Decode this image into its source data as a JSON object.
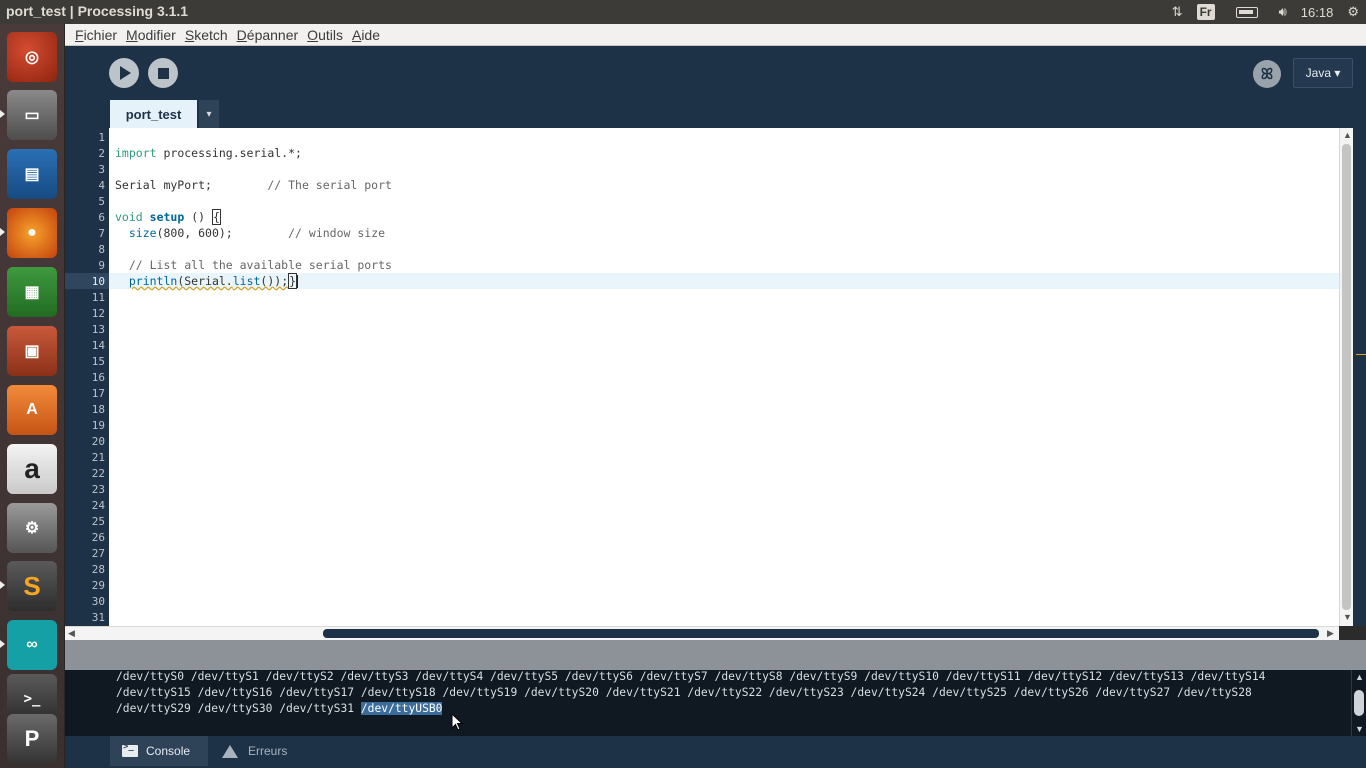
{
  "window": {
    "title": "port_test | Processing 3.1.1"
  },
  "tray": {
    "language": "Fr",
    "time": "16:18"
  },
  "launcher": {
    "apps": [
      "ubuntu-icon",
      "files-icon",
      "writer-icon",
      "firefox-icon",
      "calc-icon",
      "impress-icon",
      "software-center-icon",
      "amazon-icon",
      "system-settings-icon",
      "sublime-text-icon",
      "arduino-icon",
      "terminal-icon",
      "processing-icon"
    ]
  },
  "menu": {
    "items": [
      {
        "first": "F",
        "rest": "ichier"
      },
      {
        "first": "M",
        "rest": "odifier"
      },
      {
        "first": "S",
        "rest": "ketch"
      },
      {
        "first": "D",
        "rest": "épanner"
      },
      {
        "first": "O",
        "rest": "utils"
      },
      {
        "first": "A",
        "rest": "ide"
      }
    ]
  },
  "toolbar": {
    "mode_label": "Java ▾"
  },
  "tabs": {
    "active": "port_test",
    "menu_glyph": "▾"
  },
  "editor": {
    "line_numbers": [
      "1",
      "2",
      "3",
      "4",
      "5",
      "6",
      "7",
      "8",
      "9",
      "10",
      "11",
      "12",
      "13",
      "14",
      "15",
      "16",
      "17",
      "18",
      "19",
      "20",
      "21",
      "22",
      "23",
      "24",
      "25",
      "26",
      "27",
      "28",
      "29",
      "30",
      "31"
    ],
    "current_line": "10",
    "code": {
      "l2_kw": "import",
      "l2_rest": " processing.serial.*;",
      "l4_code": "Serial myPort;",
      "l4_comment": "        // The serial port",
      "l6_kw": "void",
      "l6_fn": "setup",
      "l6_rest": " () ",
      "l6_brace": "{",
      "l7_fn": "size",
      "l7_rest": "(800, 600);",
      "l7_comment": "        // window size",
      "l9_comment": "// List all the available serial ports",
      "l10_fn": "println",
      "l10_rest": "(Serial.",
      "l10_fn2": "list",
      "l10_end": "());",
      "l10_brace": "}"
    }
  },
  "console": {
    "line1": "/dev/ttyS0 /dev/ttyS1 /dev/ttyS2 /dev/ttyS3 /dev/ttyS4 /dev/ttyS5 /dev/ttyS6 /dev/ttyS7 /dev/ttyS8 /dev/ttyS9 /dev/ttyS10 /dev/ttyS11 /dev/ttyS12 /dev/ttyS13 /dev/ttyS14",
    "line2": "/dev/ttyS15 /dev/ttyS16 /dev/ttyS17 /dev/ttyS18 /dev/ttyS19 /dev/ttyS20 /dev/ttyS21 /dev/ttyS22 /dev/ttyS23 /dev/ttyS24 /dev/ttyS25 /dev/ttyS26 /dev/ttyS27 /dev/ttyS28",
    "line3_plain": "/dev/ttyS29 /dev/ttyS30 /dev/ttyS31 ",
    "line3_selected": "/dev/ttyUSB0"
  },
  "footer": {
    "console_label": "Console",
    "errors_label": "Erreurs"
  }
}
